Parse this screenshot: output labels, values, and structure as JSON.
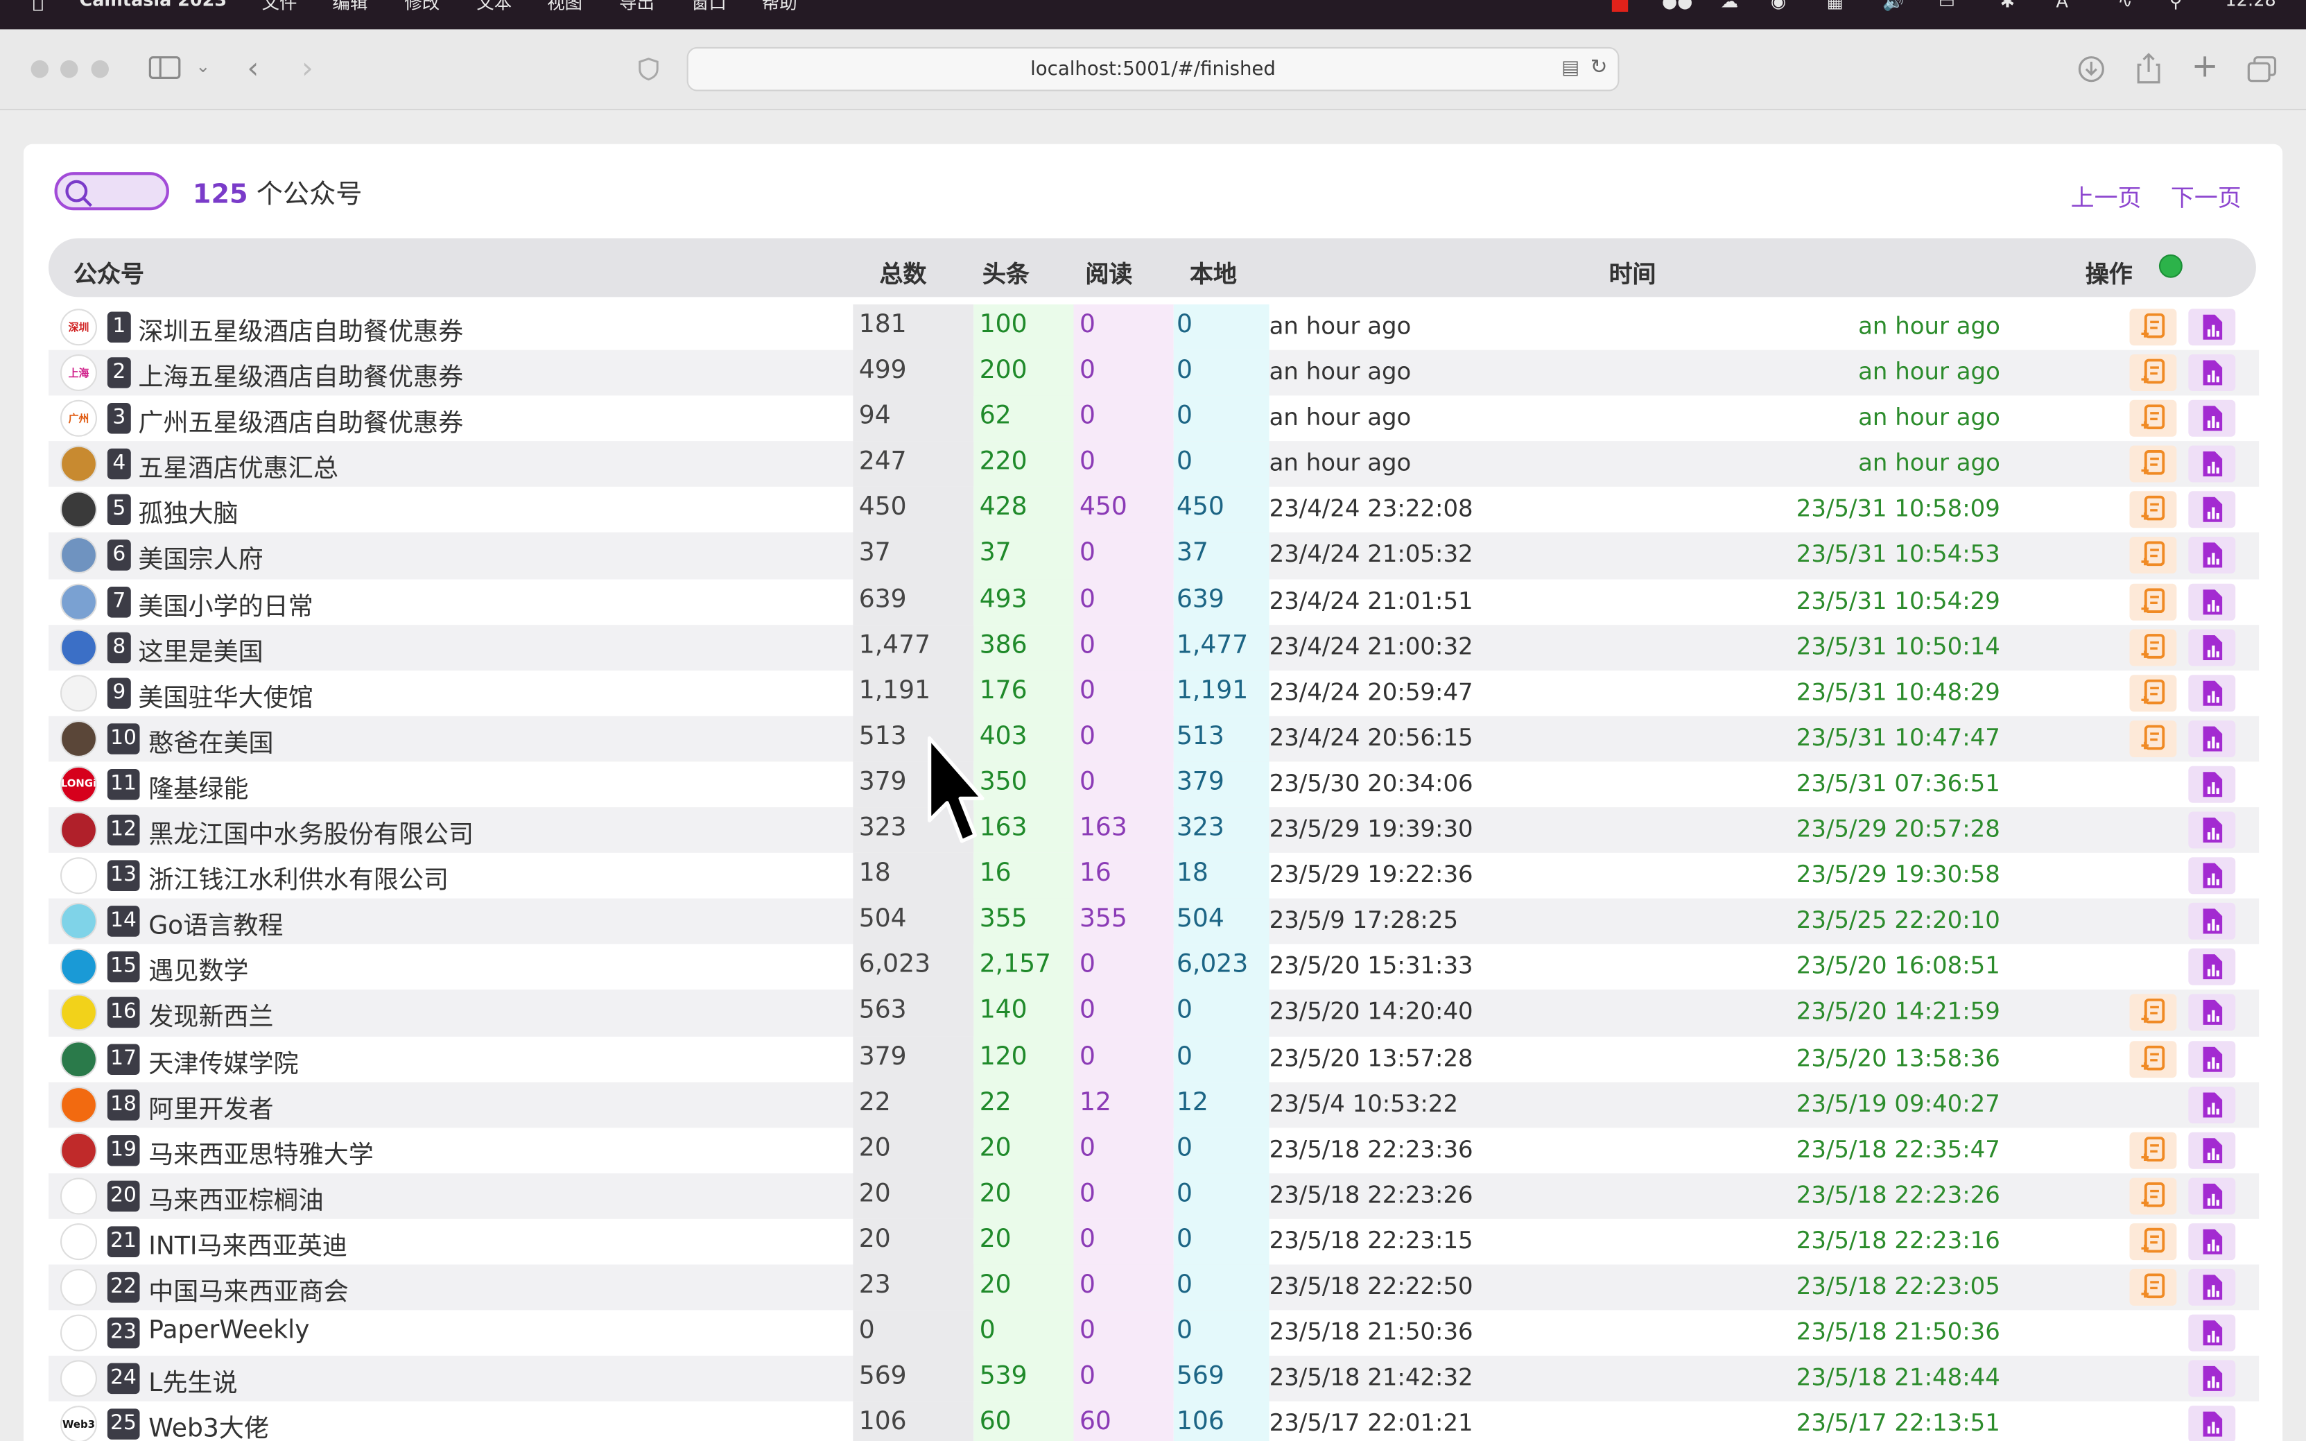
{
  "menubar": {
    "app_name": "Camtasia 2023",
    "items": [
      "文件",
      "编辑",
      "修改",
      "文本",
      "视图",
      "导出",
      "窗口",
      "帮助"
    ],
    "clock": "12:28"
  },
  "browser": {
    "url": "localhost:5001/#/finished"
  },
  "header": {
    "count": "125",
    "count_suffix": " 个公众号",
    "prev_page": "上一页",
    "next_page": "下一页"
  },
  "columns": {
    "name": "公众号",
    "total": "总数",
    "headline": "头条",
    "read": "阅读",
    "local": "本地",
    "time": "时间",
    "action": "操作"
  },
  "colors": {
    "accent": "#8c45cf",
    "status_dot": "#2cb34a",
    "headline_text": "#1f8a2a",
    "read_text": "#8b3bb6",
    "local_text": "#1c6585",
    "finish_time": "#2c8c2c"
  },
  "rows": [
    {
      "idx": "1",
      "name": "深圳五星级酒店自助餐优惠券",
      "avatar": "深圳",
      "avatar_color": "#ffffff",
      "avatar_text": "#d02020",
      "total": "181",
      "headline": "100",
      "read": "0",
      "local": "0",
      "time": "an hour ago",
      "finished": "an hour ago",
      "orange_btn": true
    },
    {
      "idx": "2",
      "name": "上海五星级酒店自助餐优惠券",
      "avatar": "上海",
      "avatar_color": "#ffffff",
      "avatar_text": "#d0208a",
      "total": "499",
      "headline": "200",
      "read": "0",
      "local": "0",
      "time": "an hour ago",
      "finished": "an hour ago",
      "orange_btn": true
    },
    {
      "idx": "3",
      "name": "广州五星级酒店自助餐优惠券",
      "avatar": "广州",
      "avatar_color": "#ffffff",
      "avatar_text": "#e05a10",
      "total": "94",
      "headline": "62",
      "read": "0",
      "local": "0",
      "time": "an hour ago",
      "finished": "an hour ago",
      "orange_btn": true
    },
    {
      "idx": "4",
      "name": "五星酒店优惠汇总",
      "avatar": "",
      "avatar_color": "#c88a30",
      "avatar_text": "#ffffff",
      "total": "247",
      "headline": "220",
      "read": "0",
      "local": "0",
      "time": "an hour ago",
      "finished": "an hour ago",
      "orange_btn": true
    },
    {
      "idx": "5",
      "name": "孤独大脑",
      "avatar": "",
      "avatar_color": "#3a3a3a",
      "avatar_text": "#ffffff",
      "total": "450",
      "headline": "428",
      "read": "450",
      "local": "450",
      "time": "23/4/24 23:22:08",
      "finished": "23/5/31 10:58:09",
      "orange_btn": true
    },
    {
      "idx": "6",
      "name": "美国宗人府",
      "avatar": "",
      "avatar_color": "#6f93c0",
      "avatar_text": "#ffffff",
      "total": "37",
      "headline": "37",
      "read": "0",
      "local": "37",
      "time": "23/4/24 21:05:32",
      "finished": "23/5/31 10:54:53",
      "orange_btn": true
    },
    {
      "idx": "7",
      "name": "美国小学的日常",
      "avatar": "",
      "avatar_color": "#7aa1d2",
      "avatar_text": "#ffffff",
      "total": "639",
      "headline": "493",
      "read": "0",
      "local": "639",
      "time": "23/4/24 21:01:51",
      "finished": "23/5/31 10:54:29",
      "orange_btn": true
    },
    {
      "idx": "8",
      "name": "这里是美国",
      "avatar": "",
      "avatar_color": "#3b6fc6",
      "avatar_text": "#ffffff",
      "total": "1,477",
      "headline": "386",
      "read": "0",
      "local": "1,477",
      "time": "23/4/24 21:00:32",
      "finished": "23/5/31 10:50:14",
      "orange_btn": true
    },
    {
      "idx": "9",
      "name": "美国驻华大使馆",
      "avatar": "",
      "avatar_color": "#f3f3f3",
      "avatar_text": "#333333",
      "total": "1,191",
      "headline": "176",
      "read": "0",
      "local": "1,191",
      "time": "23/4/24 20:59:47",
      "finished": "23/5/31 10:48:29",
      "orange_btn": true
    },
    {
      "idx": "10",
      "name": "憨爸在美国",
      "avatar": "",
      "avatar_color": "#5a4638",
      "avatar_text": "#ffffff",
      "total": "513",
      "headline": "403",
      "read": "0",
      "local": "513",
      "time": "23/4/24 20:56:15",
      "finished": "23/5/31 10:47:47",
      "orange_btn": true
    },
    {
      "idx": "11",
      "name": "隆基绿能",
      "avatar": "LONGi",
      "avatar_color": "#d6001c",
      "avatar_text": "#ffffff",
      "total": "379",
      "headline": "350",
      "read": "0",
      "local": "379",
      "time": "23/5/30 20:34:06",
      "finished": "23/5/31 07:36:51",
      "orange_btn": false
    },
    {
      "idx": "12",
      "name": "黑龙江国中水务股份有限公司",
      "avatar": "",
      "avatar_color": "#b0202a",
      "avatar_text": "#ffffff",
      "total": "323",
      "headline": "163",
      "read": "163",
      "local": "323",
      "time": "23/5/29 19:39:30",
      "finished": "23/5/29 20:57:28",
      "orange_btn": false
    },
    {
      "idx": "13",
      "name": "浙江钱江水利供水有限公司",
      "avatar": "",
      "avatar_color": "#ffffff",
      "avatar_text": "#2a6ad0",
      "total": "18",
      "headline": "16",
      "read": "16",
      "local": "18",
      "time": "23/5/29 19:22:36",
      "finished": "23/5/29 19:30:58",
      "orange_btn": false
    },
    {
      "idx": "14",
      "name": "Go语言教程",
      "avatar": "",
      "avatar_color": "#7fd3e8",
      "avatar_text": "#ffffff",
      "total": "504",
      "headline": "355",
      "read": "355",
      "local": "504",
      "time": "23/5/9 17:28:25",
      "finished": "23/5/25 22:20:10",
      "orange_btn": false
    },
    {
      "idx": "15",
      "name": "遇见数学",
      "avatar": "",
      "avatar_color": "#1a9ad6",
      "avatar_text": "#ffffff",
      "total": "6,023",
      "headline": "2,157",
      "read": "0",
      "local": "6,023",
      "time": "23/5/20 15:31:33",
      "finished": "23/5/20 16:08:51",
      "orange_btn": false
    },
    {
      "idx": "16",
      "name": "发现新西兰",
      "avatar": "",
      "avatar_color": "#f2d21a",
      "avatar_text": "#333333",
      "total": "563",
      "headline": "140",
      "read": "0",
      "local": "0",
      "time": "23/5/20 14:20:40",
      "finished": "23/5/20 14:21:59",
      "orange_btn": true
    },
    {
      "idx": "17",
      "name": "天津传媒学院",
      "avatar": "",
      "avatar_color": "#2a7a4a",
      "avatar_text": "#ffffff",
      "total": "379",
      "headline": "120",
      "read": "0",
      "local": "0",
      "time": "23/5/20 13:57:28",
      "finished": "23/5/20 13:58:36",
      "orange_btn": true
    },
    {
      "idx": "18",
      "name": "阿里开发者",
      "avatar": "",
      "avatar_color": "#f26a10",
      "avatar_text": "#ffffff",
      "total": "22",
      "headline": "22",
      "read": "12",
      "local": "12",
      "time": "23/5/4 10:53:22",
      "finished": "23/5/19 09:40:27",
      "orange_btn": false
    },
    {
      "idx": "19",
      "name": "马来西亚思特雅大学",
      "avatar": "",
      "avatar_color": "#c02a2a",
      "avatar_text": "#ffffff",
      "total": "20",
      "headline": "20",
      "read": "0",
      "local": "0",
      "time": "23/5/18 22:23:36",
      "finished": "23/5/18 22:35:47",
      "orange_btn": true
    },
    {
      "idx": "20",
      "name": "马来西亚棕榈油",
      "avatar": "",
      "avatar_color": "#ffffff",
      "avatar_text": "#2a7a2a",
      "total": "20",
      "headline": "20",
      "read": "0",
      "local": "0",
      "time": "23/5/18 22:23:26",
      "finished": "23/5/18 22:23:26",
      "orange_btn": true
    },
    {
      "idx": "21",
      "name": "INTI马来西亚英迪",
      "avatar": "",
      "avatar_color": "#ffffff",
      "avatar_text": "#c02a2a",
      "total": "20",
      "headline": "20",
      "read": "0",
      "local": "0",
      "time": "23/5/18 22:23:15",
      "finished": "23/5/18 22:23:16",
      "orange_btn": true
    },
    {
      "idx": "22",
      "name": "中国马来西亚商会",
      "avatar": "",
      "avatar_color": "#ffffff",
      "avatar_text": "#b02a2a",
      "total": "23",
      "headline": "20",
      "read": "0",
      "local": "0",
      "time": "23/5/18 22:22:50",
      "finished": "23/5/18 22:23:05",
      "orange_btn": true
    },
    {
      "idx": "23",
      "name": "PaperWeekly",
      "avatar": "",
      "avatar_color": "#ffffff",
      "avatar_text": "#2a6ad0",
      "total": "0",
      "headline": "0",
      "read": "0",
      "local": "0",
      "time": "23/5/18 21:50:36",
      "finished": "23/5/18 21:50:36",
      "orange_btn": false
    },
    {
      "idx": "24",
      "name": "L先生说",
      "avatar": "",
      "avatar_color": "#ffffff",
      "avatar_text": "#111111",
      "total": "569",
      "headline": "539",
      "read": "0",
      "local": "569",
      "time": "23/5/18 21:42:32",
      "finished": "23/5/18 21:48:44",
      "orange_btn": false
    },
    {
      "idx": "25",
      "name": "Web3大佬",
      "avatar": "Web3",
      "avatar_color": "#ffffff",
      "avatar_text": "#111111",
      "total": "106",
      "headline": "60",
      "read": "60",
      "local": "106",
      "time": "23/5/17 22:01:21",
      "finished": "23/5/17 22:13:51",
      "orange_btn": false
    }
  ]
}
